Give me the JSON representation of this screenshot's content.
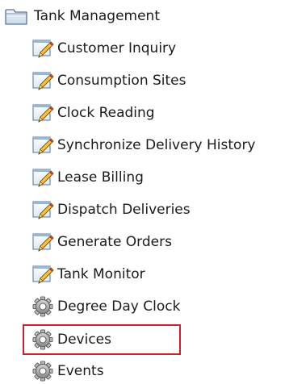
{
  "tree": {
    "root": {
      "label": "Tank Management",
      "icon": "folder-icon"
    },
    "children": [
      {
        "label": "Customer Inquiry",
        "icon": "edit-form-icon"
      },
      {
        "label": "Consumption Sites",
        "icon": "edit-form-icon"
      },
      {
        "label": "Clock Reading",
        "icon": "edit-form-icon"
      },
      {
        "label": "Synchronize Delivery History",
        "icon": "edit-form-icon"
      },
      {
        "label": "Lease Billing",
        "icon": "edit-form-icon"
      },
      {
        "label": "Dispatch Deliveries",
        "icon": "edit-form-icon"
      },
      {
        "label": "Generate Orders",
        "icon": "edit-form-icon"
      },
      {
        "label": "Tank Monitor",
        "icon": "edit-form-icon"
      },
      {
        "label": "Degree Day Clock",
        "icon": "gear-icon"
      },
      {
        "label": "Devices",
        "icon": "gear-icon",
        "highlighted": true
      },
      {
        "label": "Events",
        "icon": "gear-icon"
      }
    ]
  },
  "colors": {
    "highlight": "#c8232c",
    "text": "#1a1a1a"
  }
}
